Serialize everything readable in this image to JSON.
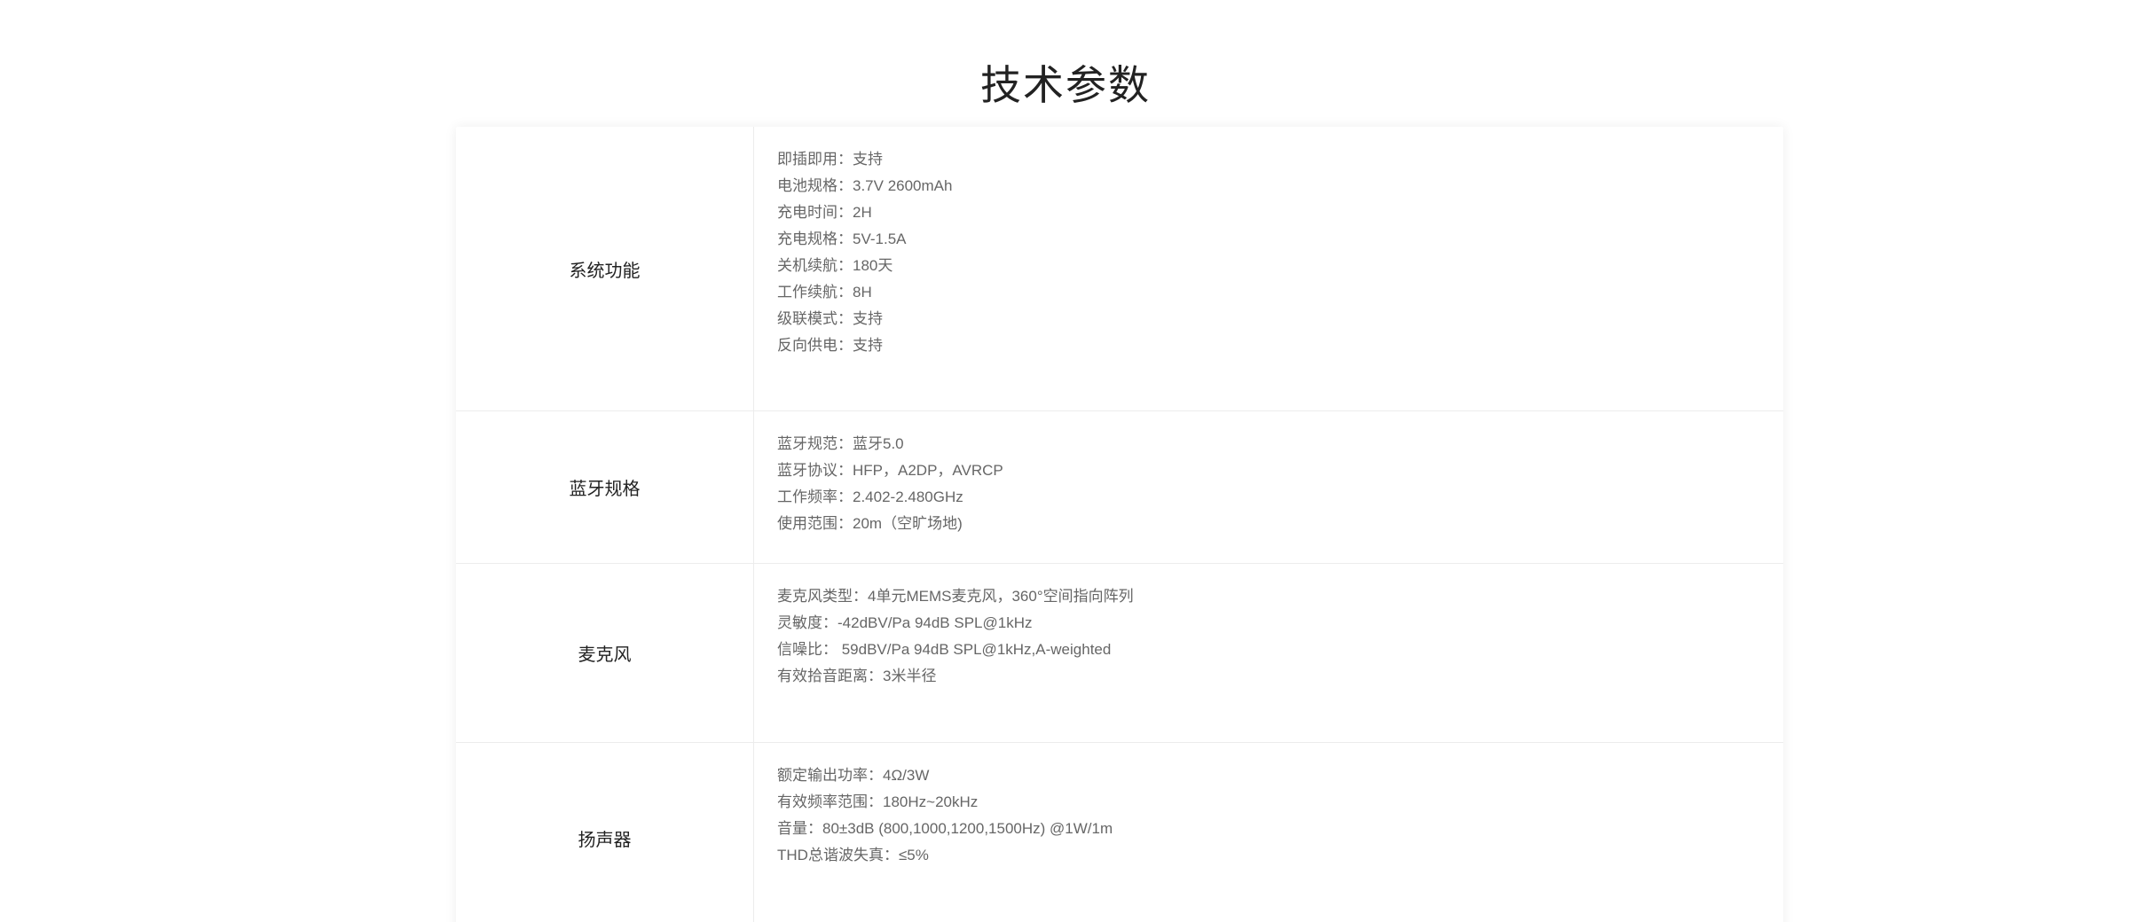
{
  "page": {
    "title": "技术参数"
  },
  "spec_groups": [
    {
      "label": "系统功能",
      "items": [
        "即插即用：支持",
        "电池规格：3.7V 2600mAh",
        "充电时间：2H",
        "充电规格：5V-1.5A",
        "关机续航：180天",
        "工作续航：8H",
        "级联模式：支持",
        "反向供电：支持"
      ]
    },
    {
      "label": "蓝牙规格",
      "items": [
        "蓝牙规范：蓝牙5.0",
        "蓝牙协议：HFP，A2DP，AVRCP",
        "工作频率：2.402-2.480GHz",
        "使用范围：20m（空旷场地)"
      ]
    },
    {
      "label": "麦克风",
      "items": [
        "麦克风类型：4单元MEMS麦克风，360°空间指向阵列",
        "灵敏度：-42dBV/Pa 94dB SPL@1kHz",
        "信噪比： 59dBV/Pa 94dB SPL@1kHz,A-weighted",
        "有效拾音距离：3米半径"
      ]
    },
    {
      "label": "扬声器",
      "items": [
        "额定输出功率：4Ω/3W",
        "有效频率范围：180Hz~20kHz",
        "音量：80±3dB (800,1000,1200,1500Hz) @1W/1m",
        "THD总谐波失真：≤5%"
      ]
    }
  ]
}
